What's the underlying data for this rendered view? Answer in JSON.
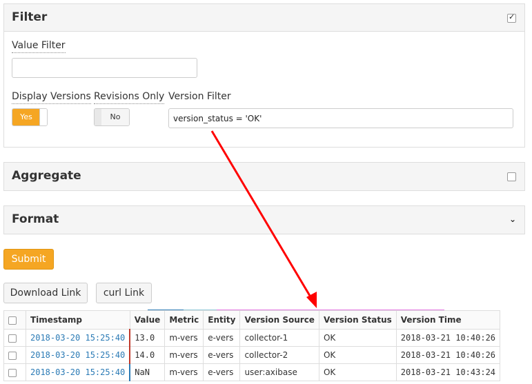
{
  "filter": {
    "title": "Filter",
    "value_filter_label": "Value Filter",
    "value_filter_value": "",
    "display_versions_label": "Display Versions",
    "display_versions_state": "Yes",
    "revisions_only_label": "Revisions Only",
    "revisions_only_state": "No",
    "version_filter_label": "Version Filter",
    "version_filter_value": "version_status = 'OK'"
  },
  "aggregate": {
    "title": "Aggregate"
  },
  "format": {
    "title": "Format"
  },
  "buttons": {
    "submit": "Submit",
    "download_link": "Download Link",
    "curl_link": "curl Link"
  },
  "table": {
    "columns": [
      "Timestamp",
      "Value",
      "Metric",
      "Entity",
      "Version Source",
      "Version Status",
      "Version Time"
    ],
    "rows": [
      [
        "2018-03-20 15:25:40",
        "13.0",
        "m-vers",
        "e-vers",
        "collector-1",
        "OK",
        "2018-03-21 10:40:26"
      ],
      [
        "2018-03-20 15:25:40",
        "14.0",
        "m-vers",
        "e-vers",
        "collector-2",
        "OK",
        "2018-03-21 10:40:26"
      ],
      [
        "2018-03-20 15:25:40",
        "NaN",
        "m-vers",
        "e-vers",
        "user:axibase",
        "OK",
        "2018-03-21 10:43:24"
      ]
    ]
  },
  "colors": {
    "accent": "#f5a623",
    "annotation_arrow": "#ff0000",
    "link": "#2a7ab5",
    "metric_col_top": "#2a7ab5",
    "entity_col_top": "#8ec6d6",
    "version_cols_top": "#e27ae0"
  }
}
